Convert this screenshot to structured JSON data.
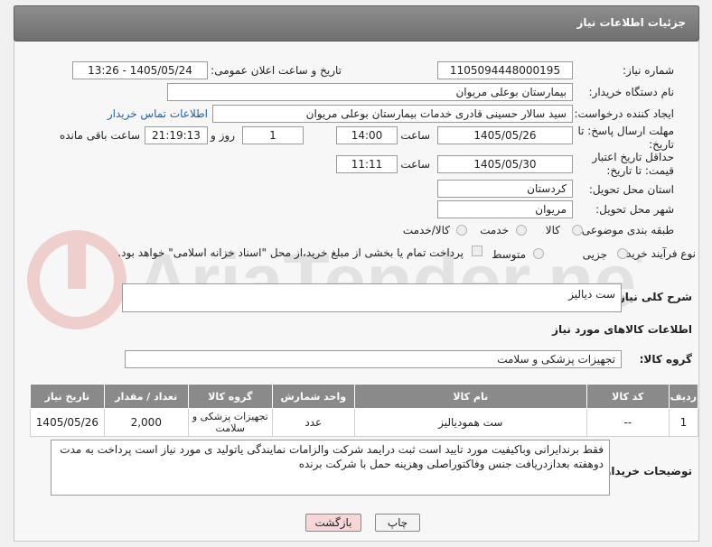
{
  "header": {
    "title": "جزئیات اطلاعات نیاز"
  },
  "need_number": {
    "label": "شماره نیاز:",
    "value": "1105094448000195"
  },
  "announce": {
    "label": "تاریخ و ساعت اعلان عمومی:",
    "value": "1405/05/24 - 13:26"
  },
  "buyer_org": {
    "label": "نام دستگاه خریدار:",
    "value": "بیمارستان بوعلی مریوان"
  },
  "requester": {
    "label": "ایجاد کننده درخواست:",
    "value": "سید سالار حسینی قادری خدمات بیمارستان بوعلی مریوان",
    "contact_link": "اطلاعات تماس خریدار"
  },
  "reply_deadline": {
    "label": "مهلت ارسال پاسخ: تا تاریخ:",
    "date": "1405/05/26",
    "time_label": "ساعت",
    "time": "14:00",
    "days": "1",
    "days_label": "روز و",
    "remaining": "21:19:13",
    "remaining_label": "ساعت باقی مانده"
  },
  "price_validity": {
    "label": "حداقل تاریخ اعتبار قیمت: تا تاریخ:",
    "date": "1405/05/30",
    "time_label": "ساعت",
    "time": "11:11"
  },
  "province": {
    "label": "استان محل تحویل:",
    "value": "کردستان"
  },
  "city": {
    "label": "شهر محل تحویل:",
    "value": "مریوان"
  },
  "category": {
    "label": "طبقه بندی موضوعی:",
    "options": [
      "کالا",
      "خدمت",
      "کالا/خدمت"
    ]
  },
  "process": {
    "label": "نوع فرآیند خرید :",
    "options": [
      "جزیی",
      "متوسط"
    ],
    "payment_note": "پرداخت تمام یا بخشی از مبلغ خرید،از محل \"اسناد خزانه اسلامی\" خواهد بود."
  },
  "description": {
    "label": "شرح کلی نیاز:",
    "value": "ست دیالیز"
  },
  "goods_info": {
    "title": "اطلاعات کالاهای مورد نیاز"
  },
  "goods_group": {
    "label": "گروه کالا:",
    "value": "تجهیزات پزشکی و سلامت"
  },
  "table": {
    "headers": [
      "ردیف",
      "کد کالا",
      "نام کالا",
      "واحد شمارش",
      "گروه کالا",
      "تعداد / مقدار",
      "تاریخ نیاز"
    ],
    "rows": [
      [
        "1",
        "--",
        "ست همودیالیز",
        "عدد",
        "تجهیزات پزشکی و سلامت",
        "2,000",
        "1405/05/26"
      ]
    ]
  },
  "buyer_notes": {
    "label": "توضیحات خریدار:",
    "value": "فقط برندایرانی وباکیفیت مورد تایید است ثبت درایمد شرکت والزامات نمایندگی یاتولید ی مورد نیاز است پرداخت به مدت دوهفته بعدازدریافت جنس وفاکتوراصلی وهزینه حمل با شرکت برنده"
  },
  "buttons": {
    "print": "چاپ",
    "back": "بازگشت"
  },
  "watermark": "AriaTender.neT",
  "colors": {
    "header": "#7a7a7a",
    "link": "#1a5fb4",
    "back_button": "#f6d6d6"
  }
}
